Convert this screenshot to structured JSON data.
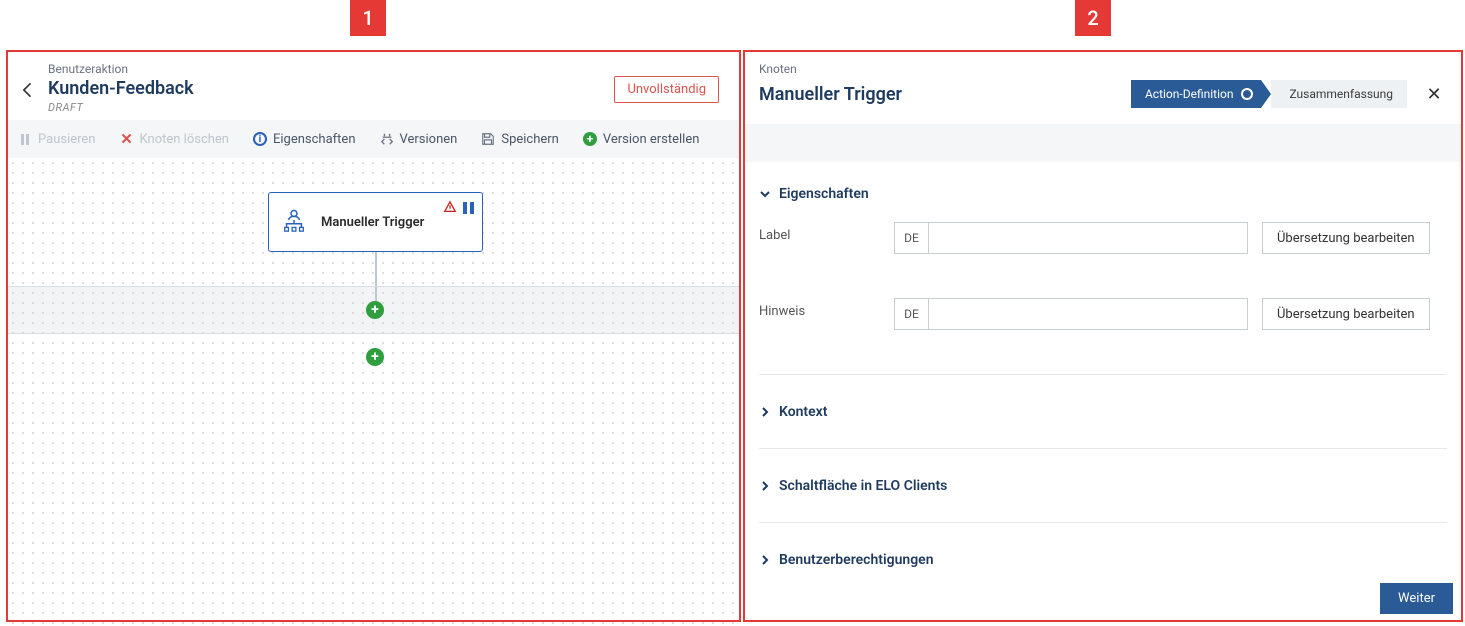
{
  "markers": {
    "one": "1",
    "two": "2"
  },
  "left": {
    "subtitle": "Benutzeraktion",
    "title": "Kunden-Feedback",
    "state": "DRAFT",
    "status_chip": "Unvollständig",
    "toolbar": {
      "pause": "Pausieren",
      "delete": "Knoten löschen",
      "props": "Eigenschaften",
      "versions": "Versionen",
      "save": "Speichern",
      "create": "Version erstellen"
    },
    "node": {
      "label": "Manueller Trigger"
    }
  },
  "right": {
    "subtitle": "Knoten",
    "title": "Manueller Trigger",
    "crumb_active": "Action-Definition",
    "crumb_next": "Zusammenfassung",
    "sections": {
      "props": "Eigenschaften",
      "context": "Kontext",
      "button_clients": "Schaltfläche in ELO Clients",
      "perms": "Benutzerberechtigungen"
    },
    "form": {
      "label_label": "Label",
      "hint_label": "Hinweis",
      "lang": "DE",
      "edit_translation": "Übersetzung bearbeiten"
    },
    "footer": "Weiter"
  }
}
